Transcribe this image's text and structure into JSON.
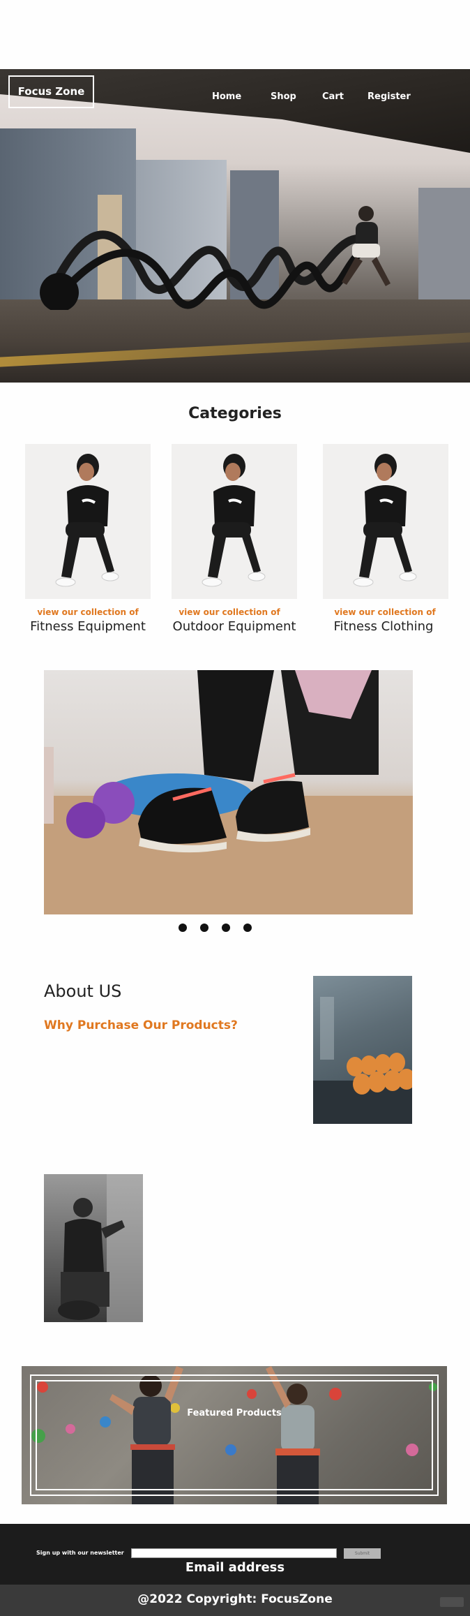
{
  "header": {
    "brand": "Focus Zone",
    "nav": [
      "Home",
      "Shop",
      "Cart",
      "Register"
    ]
  },
  "categories": {
    "title": "Categories",
    "items": [
      {
        "link": "view our collection of",
        "name": "Fitness Equipment"
      },
      {
        "link": "view our collection of",
        "name": "Outdoor Equipment"
      },
      {
        "link": "view our collection of",
        "name": "Fitness Clothing"
      }
    ]
  },
  "carousel": {
    "dots": 4
  },
  "about": {
    "title": "About US",
    "subtitle": "Why Purchase Our Products?"
  },
  "featured": {
    "label": "Featured Products"
  },
  "newsletter": {
    "label": "Sign up with our newsletter",
    "submit": "Submit",
    "placeholder": "Email address"
  },
  "footer": {
    "copyright": "@2022 Copyright: FocusZone"
  },
  "colors": {
    "accent": "#e07820",
    "footer_dark": "#1c1c1c",
    "footer_gray": "#3a3a3a"
  }
}
